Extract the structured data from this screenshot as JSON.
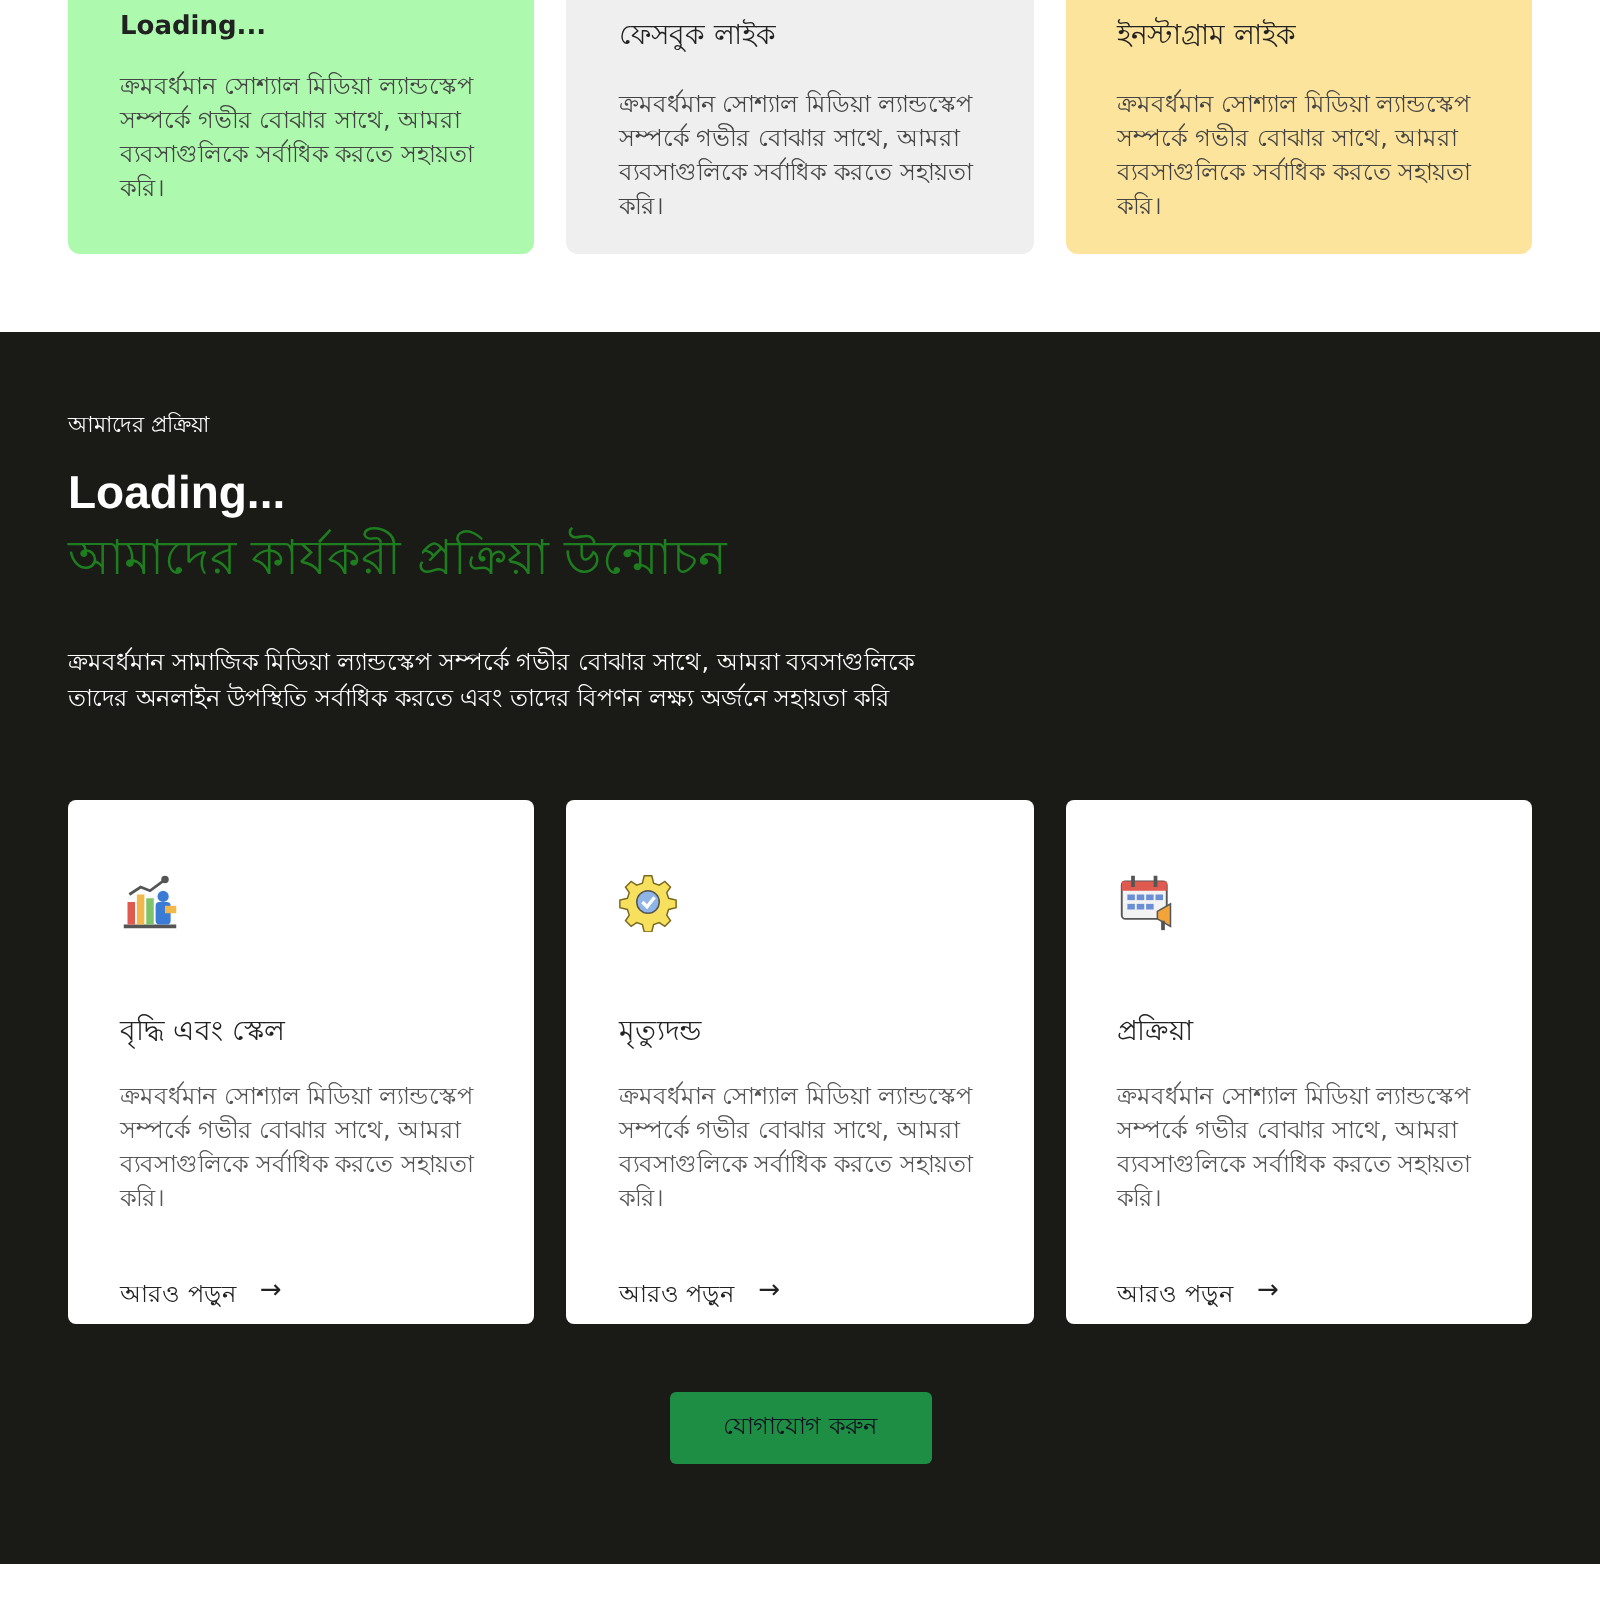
{
  "top_cards": [
    {
      "title": "Loading...",
      "text": "ক্রমবর্ধমান সোশ্যাল মিডিয়া ল্যান্ডস্কেপ সম্পর্কে গভীর বোঝার সাথে, আমরা ব্যবসাগুলিকে সর্বাধিক করতে সহায়তা করি।",
      "color": "#adf9ad"
    },
    {
      "title": "ফেসবুক লাইক",
      "text": "ক্রমবর্ধমান সোশ্যাল মিডিয়া ল্যান্ডস্কেপ সম্পর্কে গভীর বোঝার সাথে, আমরা ব্যবসাগুলিকে সর্বাধিক করতে সহায়তা করি।",
      "color": "#efefef"
    },
    {
      "title": "ইনস্টাগ্রাম লাইক",
      "text": "ক্রমবর্ধমান সোশ্যাল মিডিয়া ল্যান্ডস্কেপ সম্পর্কে গভীর বোঝার সাথে, আমরা ব্যবসাগুলিকে সর্বাধিক করতে সহায়তা করি।",
      "color": "#fde49c"
    }
  ],
  "process": {
    "eyebrow": "আমাদের প্রক্রিয়া",
    "title": "Loading...",
    "subtitle": "আমাদের কার্যকরী প্রক্রিয়া উন্মোচন",
    "description": "ক্রমবর্ধমান সামাজিক মিডিয়া ল্যান্ডস্কেপ সম্পর্কে গভীর বোঝার সাথে, আমরা ব্যবসাগুলিকে তাদের অনলাইন উপস্থিতি সর্বাধিক করতে এবং তাদের বিপণন লক্ষ্য অর্জনে সহায়তা করি",
    "cards": [
      {
        "title": "বৃদ্ধি এবং স্কেল",
        "text": "ক্রমবর্ধমান সোশ্যাল মিডিয়া ল্যান্ডস্কেপ সম্পর্কে গভীর বোঝার সাথে, আমরা ব্যবসাগুলিকে সর্বাধিক করতে সহায়তা করি।",
        "link": "আরও পড়ুন",
        "arrow": "→"
      },
      {
        "title": "মৃত্যুদন্ড",
        "text": "ক্রমবর্ধমান সোশ্যাল মিডিয়া ল্যান্ডস্কেপ সম্পর্কে গভীর বোঝার সাথে, আমরা ব্যবসাগুলিকে সর্বাধিক করতে সহায়তা করি।",
        "link": "আরও পড়ুন",
        "arrow": "→"
      },
      {
        "title": "প্রক্রিয়া",
        "text": "ক্রমবর্ধমান সোশ্যাল মিডিয়া ল্যান্ডস্কেপ সম্পর্কে গভীর বোঝার সাথে, আমরা ব্যবসাগুলিকে সর্বাধিক করতে সহায়তা করি।",
        "link": "আরও পড়ুন",
        "arrow": "→"
      }
    ],
    "button": "যোগাযোগ করুন"
  }
}
